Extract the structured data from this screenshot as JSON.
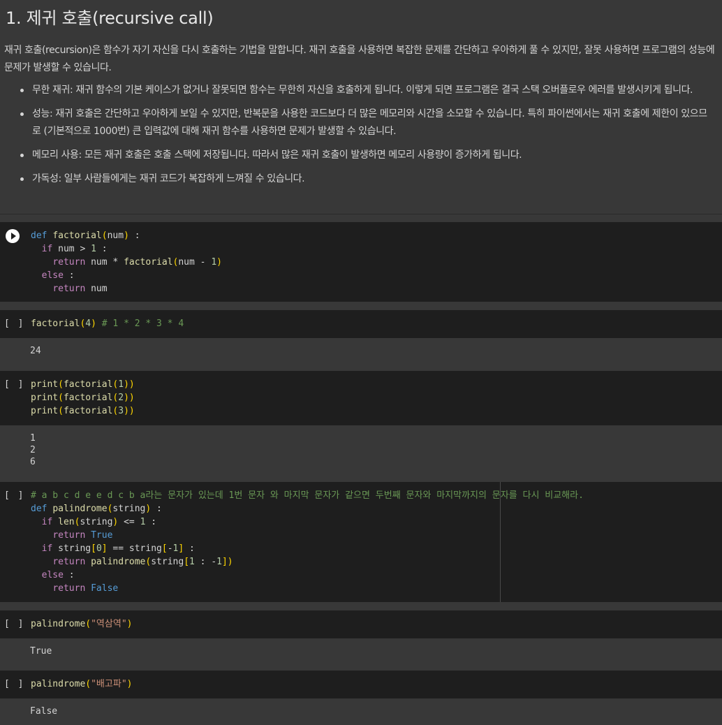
{
  "text_cell": {
    "title": "1. 제귀 호출(recursive call)",
    "intro": "재귀 호출(recursion)은 함수가 자기 자신을 다시 호출하는 기법을 말합니다. 재귀 호출을 사용하면 복잡한 문제를 간단하고 우아하게 풀 수 있지만, 잘못 사용하면 프로그램의 성능에 문제가 발생할 수 있습니다.",
    "bullets": [
      "무한 재귀: 재귀 함수의 기본 케이스가 없거나 잘못되면 함수는 무한히 자신을 호출하게 됩니다. 이렇게 되면 프로그램은 결국 스택 오버플로우 에러를 발생시키게 됩니다.",
      "성능: 재귀 호출은 간단하고 우아하게 보일 수 있지만, 반복문을 사용한 코드보다 더 많은 메모리와 시간을 소모할 수 있습니다. 특히 파이썬에서는 재귀 호출에 제한이 있으므로 (기본적으로 1000번) 큰 입력값에 대해 재귀 함수를 사용하면 문제가 발생할 수 있습니다.",
      "메모리 사용: 모든 재귀 호출은 호출 스택에 저장됩니다. 따라서 많은 재귀 호출이 발생하면 메모리 사용량이 증가하게 됩니다.",
      "가독성: 일부 사람들에게는 재귀 코드가 복잡하게 느껴질 수 있습니다."
    ]
  },
  "cells": {
    "bracket": "[ ]",
    "c1": {
      "lines": [
        "def factorial(num) :",
        "  if num > 1 :",
        "    return num * factorial(num - 1)",
        "  else :",
        "    return num"
      ]
    },
    "c2": {
      "code": "factorial(4) # 1 * 2 * 3 * 4",
      "output": "24"
    },
    "c3": {
      "lines": [
        "print(factorial(1))",
        "print(factorial(2))",
        "print(factorial(3))"
      ],
      "output": [
        "1",
        "2",
        "6"
      ]
    },
    "c4": {
      "comment": "# a b c d e e d c b a라는 문자가 있는데 1번 문자 와 마지막 문자가 같으면 두번째 문자와 마지막까지의 문자를 다시 비교해라.",
      "lines": [
        "def palindrome(string) :",
        "  if len(string) <= 1 :",
        "    return True",
        "  if string[0] == string[-1] :",
        "    return palindrome(string[1 : -1])",
        "  else :",
        "    return False"
      ]
    },
    "c5": {
      "code": "palindrome(\"역삼역\")",
      "output": "True"
    },
    "c6": {
      "code": "palindrome(\"배고파\")",
      "output": "False"
    }
  }
}
